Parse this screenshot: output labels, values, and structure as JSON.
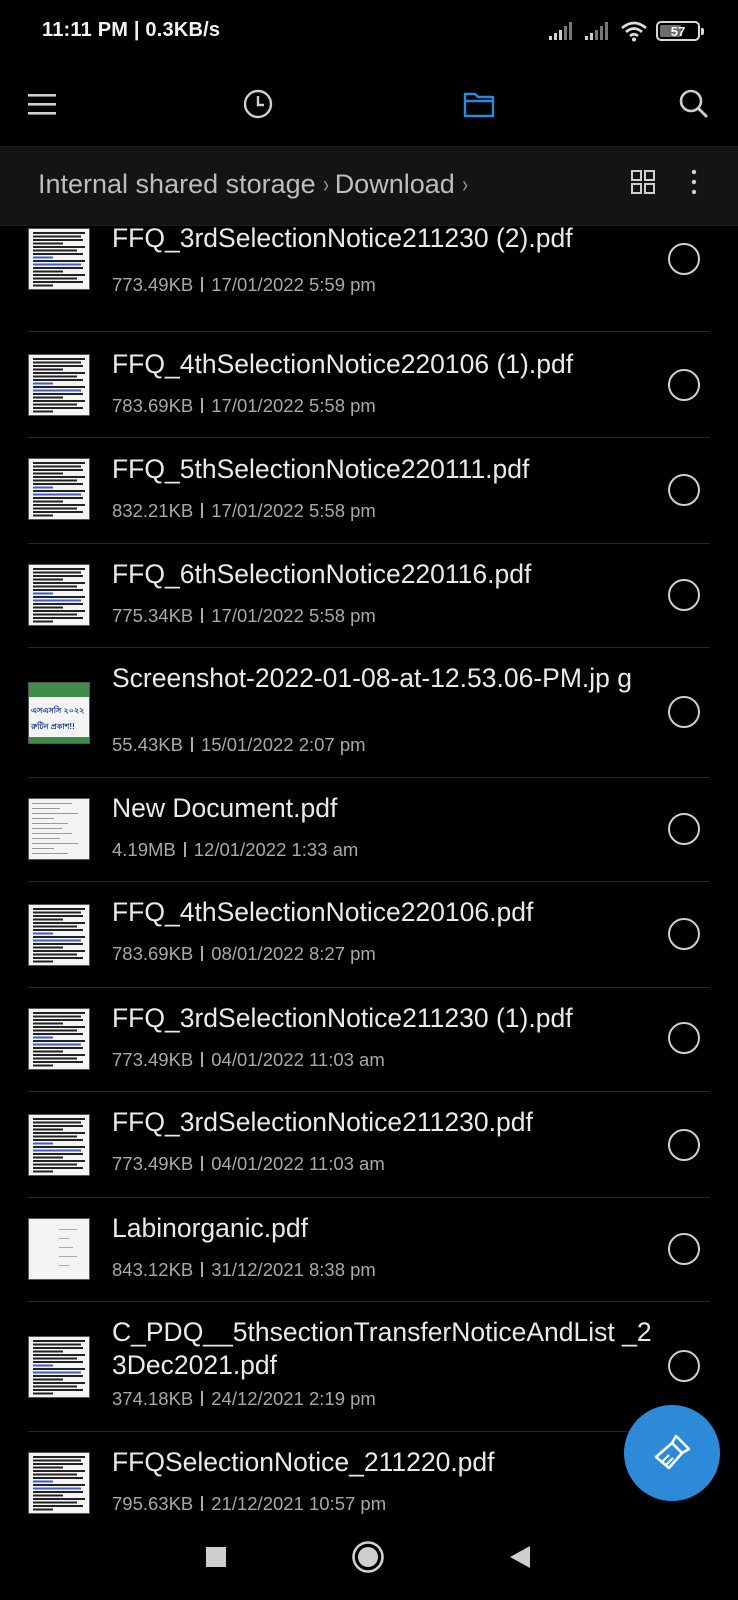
{
  "status_bar": {
    "time_speed": "11:11 PM | 0.3KB/s",
    "battery": "57",
    "battery_level": 0.57,
    "icons": [
      "signal-icon",
      "signal-icon",
      "wifi-icon",
      "battery-icon"
    ]
  },
  "toolbar": {
    "icons": [
      "menu-icon",
      "recent-clock-icon",
      "folder-icon",
      "search-icon"
    ],
    "active_color": "#2d8ad9"
  },
  "breadcrumb": {
    "items": [
      "Internal shared storage",
      "Download"
    ],
    "separator": "›",
    "actions": [
      "grid-view-icon",
      "more-vert-icon"
    ]
  },
  "files": [
    {
      "name": "FFQ_3rdSelectionNotice211230 (2).pdf",
      "size": "773.49KB",
      "date": "17/01/2022 5:59 pm",
      "thumb": "pdf-thumbnail",
      "selected": false
    },
    {
      "name": "FFQ_4thSelectionNotice220106 (1).pdf",
      "size": "783.69KB",
      "date": "17/01/2022 5:58 pm",
      "thumb": "pdf-thumbnail",
      "selected": false
    },
    {
      "name": "FFQ_5thSelectionNotice220111.pdf",
      "size": "832.21KB",
      "date": "17/01/2022 5:58 pm",
      "thumb": "pdf-thumbnail",
      "selected": false
    },
    {
      "name": "FFQ_6thSelectionNotice220116.pdf",
      "size": "775.34KB",
      "date": "17/01/2022 5:58 pm",
      "thumb": "pdf-thumbnail",
      "selected": false
    },
    {
      "name": "Screenshot-2022-01-08-at-12.53.06-PM.jp g",
      "size": "55.43KB",
      "date": "15/01/2022 2:07 pm",
      "thumb": "image-thumbnail",
      "thumb_text": [
        "এসএসসি ২০২২",
        "রুটিন প্রকাশ!!"
      ],
      "selected": false
    },
    {
      "name": "New Document.pdf",
      "size": "4.19MB",
      "date": "12/01/2022 1:33 am",
      "thumb": "doc-thumbnail",
      "selected": false
    },
    {
      "name": "FFQ_4thSelectionNotice220106.pdf",
      "size": "783.69KB",
      "date": "08/01/2022 8:27 pm",
      "thumb": "pdf-thumbnail",
      "selected": false
    },
    {
      "name": "FFQ_3rdSelectionNotice211230 (1).pdf",
      "size": "773.49KB",
      "date": "04/01/2022 11:03 am",
      "thumb": "pdf-thumbnail",
      "selected": false
    },
    {
      "name": "FFQ_3rdSelectionNotice211230.pdf",
      "size": "773.49KB",
      "date": "04/01/2022 11:03 am",
      "thumb": "pdf-thumbnail",
      "selected": false
    },
    {
      "name": "Labinorganic.pdf",
      "size": "843.12KB",
      "date": "31/12/2021 8:38 pm",
      "thumb": "doc-thumbnail",
      "selected": false
    },
    {
      "name": "C_PDQ__5thsectionTransferNoticeAndList _23Dec2021.pdf",
      "size": "374.18KB",
      "date": "24/12/2021 2:19 pm",
      "thumb": "pdf-thumbnail",
      "selected": false
    },
    {
      "name": "FFQSelectionNotice_211220.pdf",
      "size": "795.63KB",
      "date": "21/12/2021 10:57 pm",
      "thumb": "pdf-thumbnail",
      "selected": false
    }
  ],
  "fab": {
    "icon": "cleaner-brush-icon",
    "color": "#2d8ad9"
  },
  "nav_bar": {
    "icons": [
      "recents-square-icon",
      "home-circle-icon",
      "back-triangle-icon"
    ]
  }
}
